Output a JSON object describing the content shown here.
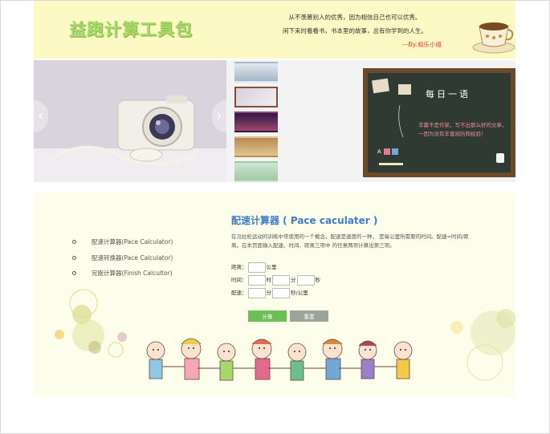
{
  "header": {
    "logo_text": "益跑计算工具包",
    "motto_line1": "从不羡慕别人的优秀，因为相信自己也可以优秀。",
    "motto_line2": "闲下来时看看书，书本里的故事，总有你学到的人生。",
    "motto_signature": "---By:和乐小组"
  },
  "banner": {
    "board_title": "每日一语",
    "board_text": "羊羹不是作家，写不出那么好的文章，一因为没有丰富阅历和经验！"
  },
  "sidebar": {
    "items": [
      {
        "label": "配速计算器(Pace Calculator)"
      },
      {
        "label": "配速转换器(Pace Calculator)"
      },
      {
        "label": "完跑计算器(Finish Calcultor)"
      }
    ]
  },
  "calculator": {
    "title": "配速计算器 ( Pace caculater )",
    "description": "在马拉松运动的训练中常使用的一个概念，配速是速度的一种， 是每公里所需要的时间。配速=时间/距离。在本页面输入配速、时间、距离三项中 的任意两项计算出第三项。",
    "distance_label": "距离：",
    "distance_unit": "公里",
    "time_label": "时间：",
    "hour_unit": "时",
    "minute_unit": "分",
    "second_unit": "秒",
    "pace_label": "配速：",
    "pace_minute_unit": "分",
    "pace_unit": "秒/公里",
    "calc_button": "计算",
    "reset_button": "重置"
  },
  "colors": {
    "header_bg": "#fdf9c4",
    "logo_green": "#a8d96a",
    "title_blue": "#3f7cc5",
    "calc_green": "#6cbf54",
    "reset_gray": "#9aa49a",
    "signature_red": "#e0392c"
  }
}
